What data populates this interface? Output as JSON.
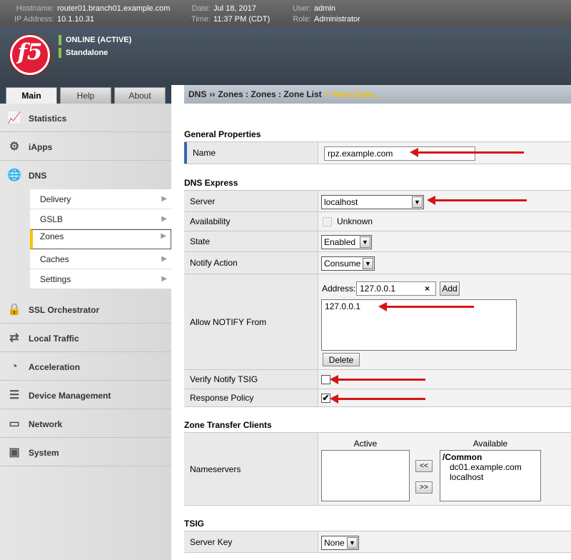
{
  "topbar": {
    "hostname_label": "Hostname:",
    "hostname": "router01.branch01.example.com",
    "ip_label": "IP Address:",
    "ip": "10.1.10.31",
    "date_label": "Date:",
    "date": "Jul 18, 2017",
    "time_label": "Time:",
    "time": "11:37 PM (CDT)",
    "user_label": "User:",
    "user": "admin",
    "role_label": "Role:",
    "role": "Administrator"
  },
  "banner": {
    "logo": "f5",
    "status_online": "ONLINE (ACTIVE)",
    "status_mode": "Standalone",
    "status_color": "#8bc34a"
  },
  "tabs": [
    "Main",
    "Help",
    "About"
  ],
  "breadcrumb": {
    "parts": [
      "DNS",
      "Zones : Zones : Zone List"
    ],
    "current": "New Zone...",
    "sep": "››"
  },
  "sidebar": {
    "items": [
      {
        "label": "Statistics",
        "icon": "statistics-icon",
        "glyph": "📈"
      },
      {
        "label": "iApps",
        "icon": "iapps-icon",
        "glyph": "⚙"
      },
      {
        "label": "DNS",
        "icon": "dns-globe-icon",
        "glyph": "🌐"
      },
      {
        "label": "SSL Orchestrator",
        "icon": "lock-icon",
        "glyph": "🔒"
      },
      {
        "label": "Local Traffic",
        "icon": "local-traffic-icon",
        "glyph": "⇄"
      },
      {
        "label": "Acceleration",
        "icon": "gauge-icon",
        "glyph": "◔"
      },
      {
        "label": "Device Management",
        "icon": "device-icon",
        "glyph": "☰"
      },
      {
        "label": "Network",
        "icon": "network-icon",
        "glyph": "▭"
      },
      {
        "label": "System",
        "icon": "system-icon",
        "glyph": "▣"
      }
    ],
    "dns_sub": [
      "Delivery",
      "GSLB",
      "Zones",
      "Caches",
      "Settings"
    ],
    "accent": "#f5c400"
  },
  "general": {
    "heading": "General Properties",
    "name_label": "Name",
    "name_value": "rpz.example.com"
  },
  "dnsx": {
    "heading": "DNS Express",
    "server_label": "Server",
    "server_value": "localhost",
    "availability_label": "Availability",
    "availability_value": "Unknown",
    "state_label": "State",
    "state_value": "Enabled",
    "notify_action_label": "Notify Action",
    "notify_action_value": "Consume",
    "allow_notify_label": "Allow NOTIFY From",
    "address_label": "Address:",
    "address_value": "127.0.0.1",
    "clear_glyph": "×",
    "add_button": "Add",
    "notify_list": [
      "127.0.0.1"
    ],
    "delete_button": "Delete",
    "verify_tsig_label": "Verify Notify TSIG",
    "verify_tsig_checked": false,
    "response_policy_label": "Response Policy",
    "response_policy_checked": true
  },
  "ztc": {
    "heading": "Zone Transfer Clients",
    "nameservers_label": "Nameservers",
    "active_label": "Active",
    "available_label": "Available",
    "move_left": "<<",
    "move_right": ">>",
    "available_group": "/Common",
    "available_items": [
      "dc01.example.com",
      "localhost"
    ]
  },
  "tsig": {
    "heading": "TSIG",
    "server_key_label": "Server Key",
    "server_key_value": "None"
  },
  "annotation_color": "#d41515"
}
